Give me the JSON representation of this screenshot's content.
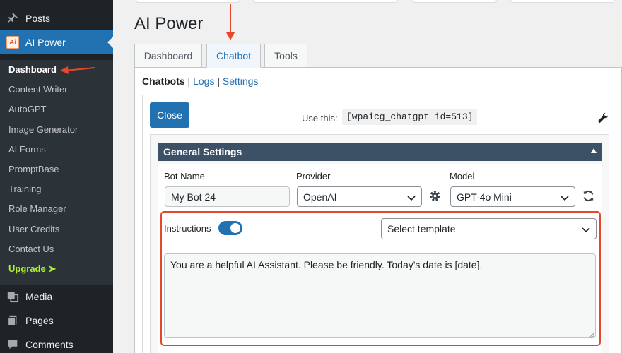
{
  "sidebar": {
    "posts_label": "Posts",
    "plugin_label": "AI Power",
    "plugin_logo_text": "Ai",
    "submenu": [
      "Dashboard",
      "Content Writer",
      "AutoGPT",
      "Image Generator",
      "AI Forms",
      "PromptBase",
      "Training",
      "Role Manager",
      "User Credits",
      "Contact Us",
      "Upgrade ➤"
    ],
    "media_label": "Media",
    "pages_label": "Pages",
    "comments_label": "Comments"
  },
  "page": {
    "title": "AI Power"
  },
  "tabs": [
    "Dashboard",
    "Chatbot",
    "Tools"
  ],
  "active_tab": "Chatbot",
  "sublinks": {
    "chatbots": "Chatbots",
    "sep1": " | ",
    "logs": "Logs",
    "sep2": " | ",
    "settings": "Settings"
  },
  "editor": {
    "close_label": "Close",
    "use_this_label": "Use this:",
    "shortcode": "[wpaicg_chatgpt id=513]"
  },
  "general_settings": {
    "title": "General Settings",
    "bot_name_label": "Bot Name",
    "bot_name_value": "My Bot 24",
    "provider_label": "Provider",
    "provider_value": "OpenAI",
    "model_label": "Model",
    "model_value": "GPT-4o Mini",
    "instructions_label": "Instructions",
    "instructions_enabled": true,
    "template_value": "Select template",
    "instructions_text": "You are a helpful AI Assistant. Please be friendly. Today's date is [date]."
  },
  "colors": {
    "accent": "#2271b1",
    "sidebar": "#1d2327",
    "highlight": "#e3482c",
    "header": "#3c5166",
    "upgrade": "#aef02b"
  }
}
